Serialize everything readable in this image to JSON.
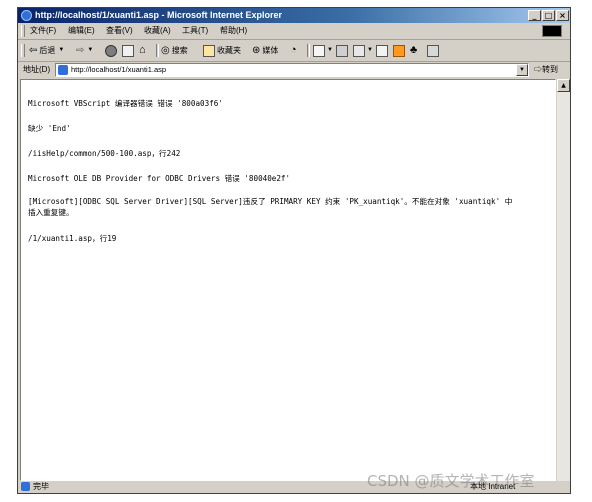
{
  "window": {
    "title": "http://localhost/1/xuanti1.asp - Microsoft Internet Explorer",
    "controls": {
      "minimize": "_",
      "maximize": "□",
      "close": "×"
    }
  },
  "menu": [
    "文件(F)",
    "编辑(E)",
    "查看(V)",
    "收藏(A)",
    "工具(T)",
    "帮助(H)"
  ],
  "toolbar": {
    "back": "后退",
    "search": "搜索",
    "favorites": "收藏夹",
    "media": "媒体"
  },
  "address": {
    "label": "地址(D)",
    "url": "http://localhost/1/xuanti1.asp",
    "go": "转到"
  },
  "content": {
    "lines": [
      "Microsoft VBScript 编译器错误 错误 '800a03f6'",
      "缺少 'End'",
      "/iisHelp/common/500-100.asp，行242",
      "Microsoft OLE DB Provider for ODBC Drivers 错误 '80040e2f'",
      "[Microsoft][ODBC SQL Server Driver][SQL Server]违反了 PRIMARY KEY 约束 'PK_xuantiqk'。不能在对象 'xuantiqk' 中",
      "插入重复键。",
      "/1/xuanti1.asp，行19"
    ]
  },
  "status": {
    "text": "完毕",
    "zone": "本地 Intranet"
  },
  "watermark": "CSDN @质文学术工作室",
  "colors": {
    "titlebar_start": "#0a246a",
    "titlebar_end": "#a6caf0",
    "chrome": "#d4d0c8"
  }
}
